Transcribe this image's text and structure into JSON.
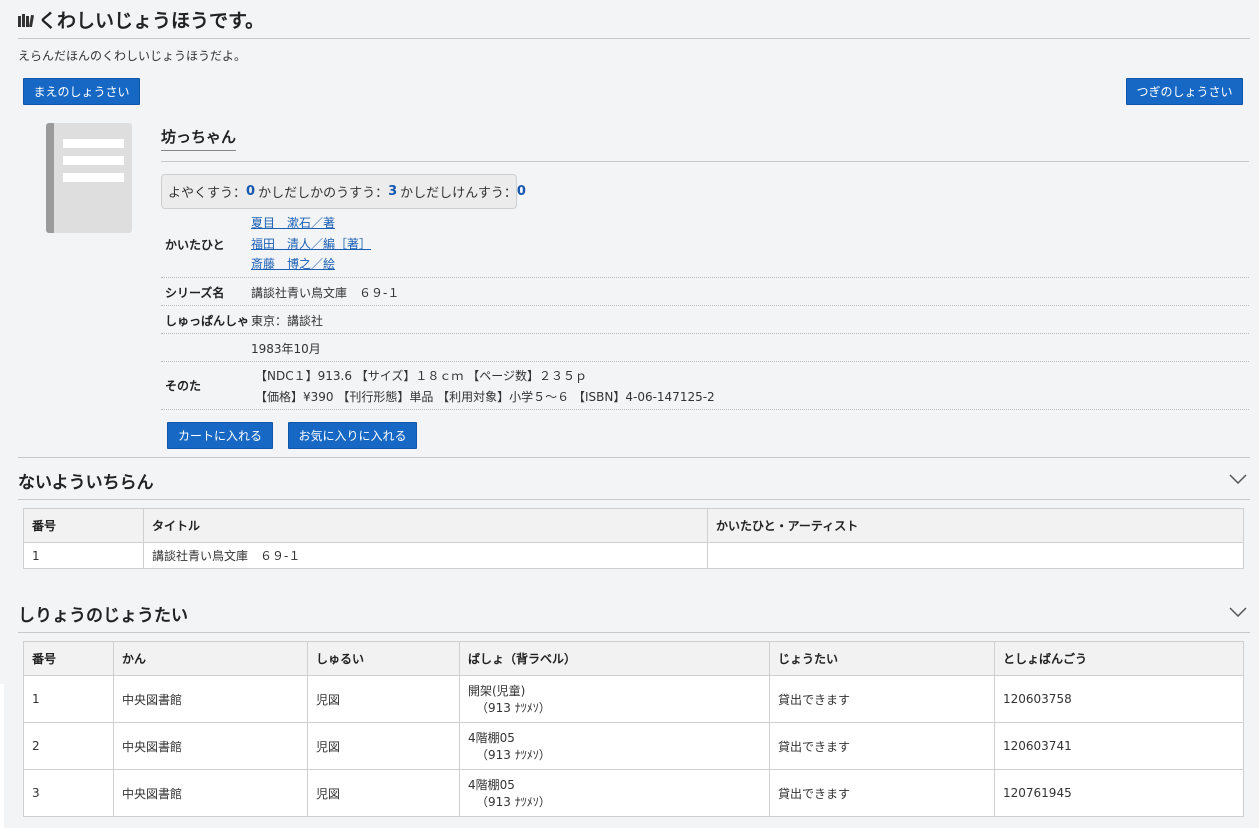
{
  "header": {
    "title": "くわしいじょうほうです。",
    "lead": "えらんだほんのくわしいじょうほうだよ。"
  },
  "nav": {
    "prev_label": "まえのしょうさい",
    "next_label": "つぎのしょうさい"
  },
  "book": {
    "title": "坊っちゃん",
    "counts": {
      "reserve_label": "よやくすう：",
      "reserve_value": "0",
      "lendable_label": "かしだしかのうすう：",
      "lendable_value": "3",
      "lent_label": "かしだしけんすう：",
      "lent_value": "0"
    },
    "authors_label": "かいたひと",
    "authors": [
      "夏目　漱石／著",
      "福田　清人／編［著］",
      "斎藤　博之／絵"
    ],
    "series_label": "シリーズ名",
    "series": "講談社青い鳥文庫　６９-１",
    "publisher_label": "しゅっぱんしゃ",
    "publisher": "東京：講談社",
    "date": "1983年10月",
    "other_label": "そのた",
    "other_line1": "【NDC１】913.6 【サイズ】１８ｃｍ 【ページ数】２３５ｐ",
    "other_line2": "【価格】¥390 【刊行形態】単品 【利用対象】小学５～６ 【ISBN】4-06-147125-2",
    "cart_label": "カートに入れる",
    "favorite_label": "お気に入りに入れる"
  },
  "contents": {
    "title": "ないよういちらん",
    "headers": [
      "番号",
      "タイトル",
      "かいたひと・アーティスト"
    ],
    "rows": [
      [
        "1",
        "講談社青い鳥文庫　６９-１",
        ""
      ]
    ]
  },
  "holdings": {
    "title": "しりょうのじょうたい",
    "headers": [
      "番号",
      "かん",
      "しゅるい",
      "ばしょ（背ラベル）",
      "じょうたい",
      "としょばんごう"
    ],
    "rows": [
      {
        "no": "1",
        "library": "中央図書館",
        "kind": "児図",
        "place": "開架(児童)",
        "label": "（913 ﾅﾂﾒｿ）",
        "status": "貸出できます",
        "barcode": "120603758"
      },
      {
        "no": "2",
        "library": "中央図書館",
        "kind": "児図",
        "place": "4階棚05",
        "label": "（913 ﾅﾂﾒｿ）",
        "status": "貸出できます",
        "barcode": "120603741"
      },
      {
        "no": "3",
        "library": "中央図書館",
        "kind": "児図",
        "place": "4階棚05",
        "label": "（913 ﾅﾂﾒｿ）",
        "status": "貸出できます",
        "barcode": "120761945"
      }
    ]
  },
  "colors": {
    "accent": "#1668c4",
    "link": "#1a5fb4",
    "background": "#f3f4f6"
  }
}
